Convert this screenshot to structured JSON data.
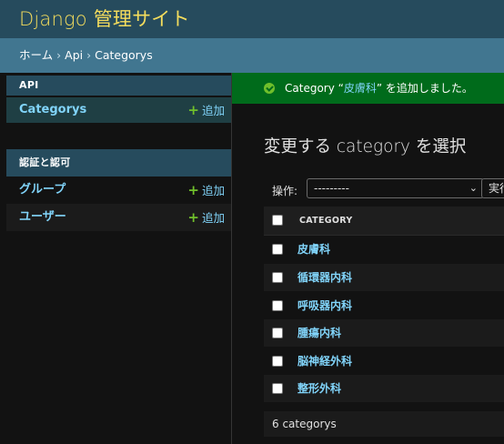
{
  "header": {
    "branding": "Django 管理サイト"
  },
  "breadcrumbs": {
    "home": "ホーム",
    "sep1": "›",
    "app": "Api",
    "sep2": "›",
    "current": "Categorys"
  },
  "sidebar": {
    "modules": [
      {
        "caption": "API",
        "models": [
          {
            "name": "Categorys",
            "add_label": "追加",
            "selected": true
          }
        ]
      },
      {
        "caption": "認証と認可",
        "models": [
          {
            "name": "グループ",
            "add_label": "追加"
          },
          {
            "name": "ユーザー",
            "add_label": "追加"
          }
        ]
      }
    ]
  },
  "message": {
    "prefix": "Category “",
    "link": "皮膚科",
    "suffix": "” を追加しました。"
  },
  "page_title": "変更する category を選択",
  "actions": {
    "label": "操作:",
    "select_value": "---------",
    "run_label": "実行"
  },
  "table": {
    "column_header": "CATEGORY",
    "rows": [
      "皮膚科",
      "循環器内科",
      "呼吸器内科",
      "腫瘍内科",
      "脳神経外科",
      "整形外科"
    ]
  },
  "paginator": "6 categorys",
  "colors": {
    "header_bg": "#264b5d",
    "breadcrumb_bg": "#417690",
    "branding": "#f5dd5d",
    "link": "#81d4fa",
    "success_bg": "#006b1b",
    "add_plus": "#70bf2b"
  }
}
